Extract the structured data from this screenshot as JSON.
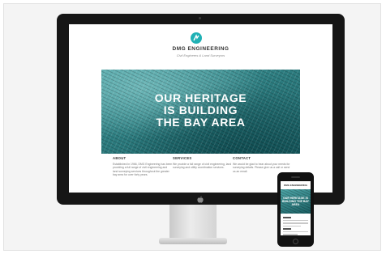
{
  "site": {
    "brand": "DMG ENGINEERING",
    "tagline": "Civil Engineers & Land Surveyors",
    "hero": {
      "line1": "OUR HERITAGE",
      "line2": "IS BUILDING",
      "line3": "THE BAY AREA"
    },
    "columns": [
      {
        "heading": "ABOUT",
        "text": "Established in 1966, DMG Engineering has been providing a full range of civil engineering and land surveying services throughout the greater bay area for over forty years."
      },
      {
        "heading": "SERVICES",
        "text": "We provide a full range of civil engineering, land surveying and utility coordination services."
      },
      {
        "heading": "CONTACT",
        "text": "We would be glad to hear about your needs for surveying details. Please give us a call or send us an email."
      }
    ]
  },
  "phone_site": {
    "brand": "DMG ENGINEERING",
    "hero": "OUR HERITAGE IS BUILDING THE BAY AREA"
  },
  "colors": {
    "accent": "#1fb1b5",
    "bezel": "#161616",
    "hero_teal": "#2d7d80"
  }
}
